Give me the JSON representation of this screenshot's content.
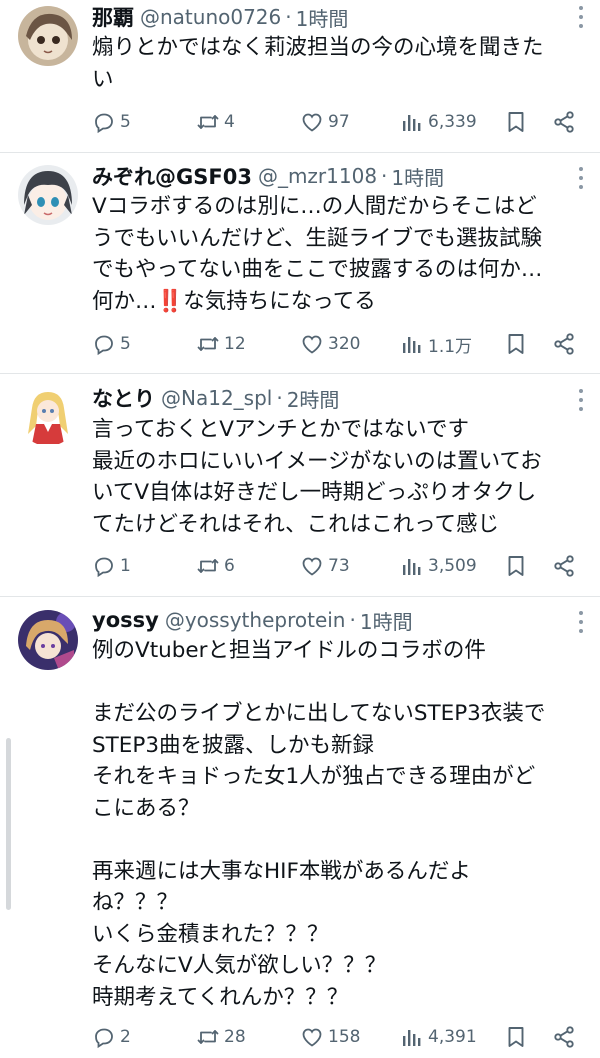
{
  "tweets": [
    {
      "display_name": "那覇",
      "handle": "@natuno0726",
      "separator": "·",
      "time": "1時間",
      "avatar_icon": "avatar-anime-girl-sepia",
      "lines": [
        "煽りとかではなく莉波担当の今の心境を聞きた",
        "い"
      ],
      "replies": "5",
      "retweets": "4",
      "likes": "97",
      "views": "6,339"
    },
    {
      "display_name": "みぞれ@GSF03",
      "handle": "@_mzr1108",
      "separator": "·",
      "time": "1時間",
      "avatar_icon": "avatar-anime-girl-gray-hair",
      "lines": [
        "Vコラボするのは別に…の人間だからそこはど",
        "うでもいいんだけど、生誕ライブでも選抜試験",
        "でもやってない曲をここで披露するのは何か…",
        "何か…‼️な気持ちになってる"
      ],
      "replies": "5",
      "retweets": "12",
      "likes": "320",
      "views": "1.1万"
    },
    {
      "display_name": "なとり",
      "handle": "@Na12_spl",
      "separator": "·",
      "time": "2時間",
      "avatar_icon": "avatar-chibi-blonde-girl",
      "lines": [
        "言っておくとVアンチとかではないです",
        "最近のホロにいいイメージがないのは置いてお",
        "いてV自体は好きだし一時期どっぷりオタクし",
        "てたけどそれはそれ、これはこれって感じ"
      ],
      "replies": "1",
      "retweets": "6",
      "likes": "73",
      "views": "3,509"
    },
    {
      "display_name": "yossy",
      "handle": "@yossytheprotein",
      "separator": "·",
      "time": "1時間",
      "avatar_icon": "avatar-anime-girl-purple",
      "lines": [
        "例のVtuberと担当アイドルのコラボの件",
        "",
        "まだ公のライブとかに出してないSTEP3衣装で",
        "STEP3曲を披露、しかも新録",
        "それをキョドった女1人が独占できる理由がど",
        "こにある？",
        "",
        "再来週には大事なHIF本戦があるんだよ",
        "ね？？？",
        "いくら金積まれた？？？",
        "そんなにV人気が欲しい？？？",
        "時期考えてくれんか？？？"
      ],
      "replies": "2",
      "retweets": "28",
      "likes": "158",
      "views": "4,391"
    }
  ]
}
